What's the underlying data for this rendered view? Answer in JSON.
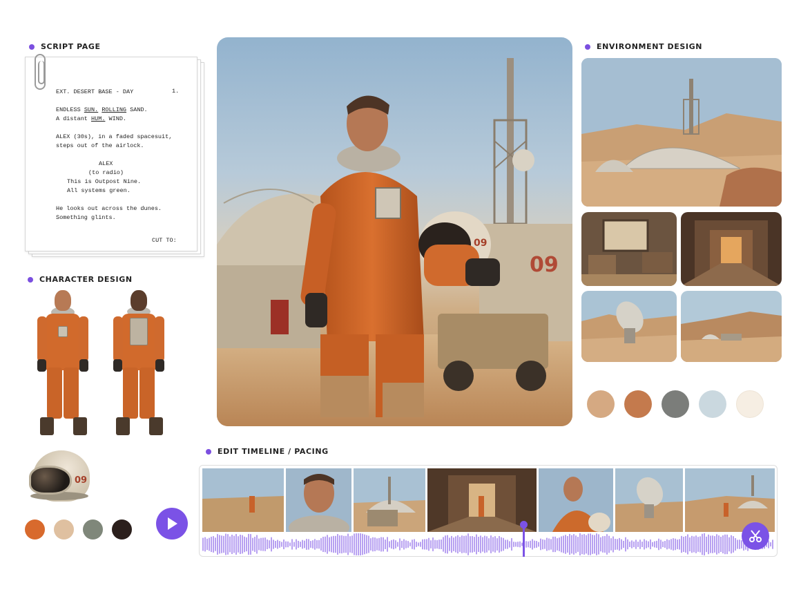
{
  "sections": {
    "script_page": "SCRIPT PAGE",
    "character_design": "CHARACTER DESIGN",
    "environment_design": "ENVIRONMENT DESIGN",
    "edit_timeline": "EDIT TIMELINE / PACING"
  },
  "script": {
    "heading": "EXT. DESERT BASE - DAY",
    "scene_number": "1.",
    "action1_line1_a": "ENDLESS ",
    "action1_line1_sun": "SUN.",
    "action1_line1_b": " ",
    "action1_line1_rolling": "ROLLING",
    "action1_line1_c": " SAND.",
    "action1_line2_a": "A distant ",
    "action1_line2_hum": "HUM.",
    "action1_line2_b": " WIND.",
    "action2_line1": "ALEX (30s), in a faded spacesuit,",
    "action2_line2": "steps out of the airlock.",
    "character": "ALEX",
    "parenthetical": "(to radio)",
    "dialogue1": "This is Outpost Nine.",
    "dialogue2": "All systems green.",
    "action3_line1": "He looks out across the dunes.",
    "action3_line2": "Something glints.",
    "transition": "CUT TO:"
  },
  "props": {
    "helmet_number": "09"
  },
  "hero": {
    "tower_number": "09",
    "helmet_number": "09"
  },
  "character_palette": [
    "#d86a2d",
    "#dfc0a0",
    "#7f877a",
    "#2b1f1c"
  ],
  "environment_palette": [
    "#d5a982",
    "#c47a4d",
    "#7b7d7a",
    "#cad8df",
    "#f6eee3"
  ],
  "accent_color": "#7b52e6",
  "timeline": {
    "playhead_position": 0.56
  }
}
